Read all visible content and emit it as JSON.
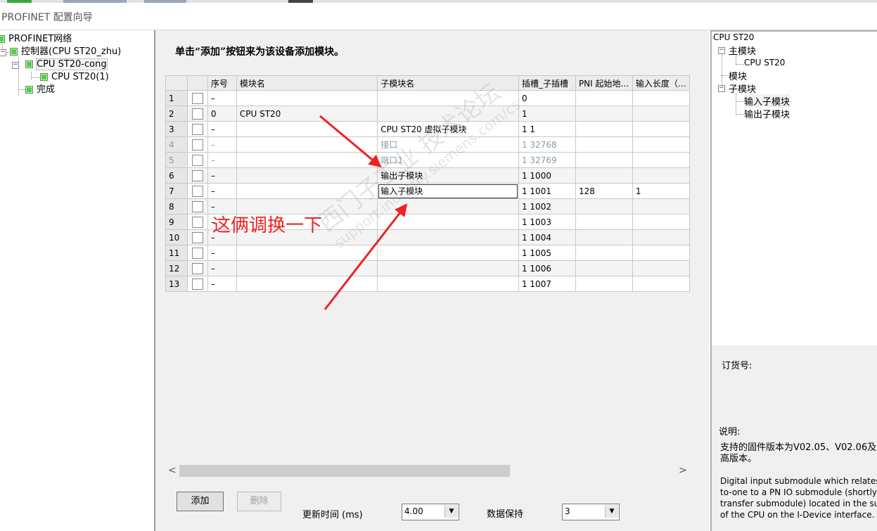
{
  "window": {
    "title": "PROFINET 配置向导"
  },
  "left_tree": {
    "items": [
      {
        "label": "PROFINET网络"
      },
      {
        "label": "控制器(CPU ST20_zhu)"
      },
      {
        "label": "CPU ST20-cong"
      },
      {
        "label": "CPU ST20(1)"
      },
      {
        "label": "完成"
      }
    ]
  },
  "center": {
    "instruction": "单击“添加”按钮来为该设备添加模块。",
    "columns": [
      "序号",
      "模块名",
      "子模块名",
      "插槽_子插槽",
      "PNI 起始地…",
      "输入长度（…"
    ],
    "rows": [
      {
        "num": "1",
        "seq": "–",
        "module": "",
        "submodule": "",
        "slot": "0",
        "pni": "",
        "len": ""
      },
      {
        "num": "2",
        "seq": "0",
        "module": "CPU ST20",
        "submodule": "",
        "slot": "1",
        "pni": "",
        "len": ""
      },
      {
        "num": "3",
        "seq": "–",
        "module": "",
        "submodule": "CPU ST20 虚拟子模块",
        "slot": "1 1",
        "pni": "",
        "len": ""
      },
      {
        "num": "4",
        "seq": "–",
        "module": "",
        "submodule": "接口",
        "slot": "1 32768",
        "pni": "",
        "len": ""
      },
      {
        "num": "5",
        "seq": "–",
        "module": "",
        "submodule": "端口1",
        "slot": "1 32769",
        "pni": "",
        "len": ""
      },
      {
        "num": "6",
        "seq": "–",
        "module": "",
        "submodule": "输出子模块",
        "slot": "1 1000",
        "pni": "",
        "len": ""
      },
      {
        "num": "7",
        "seq": "–",
        "module": "",
        "submodule": "输入子模块",
        "slot": "1 1001",
        "pni": "128",
        "len": "1"
      },
      {
        "num": "8",
        "seq": "–",
        "module": "",
        "submodule": "",
        "slot": "1 1002",
        "pni": "",
        "len": ""
      },
      {
        "num": "9",
        "seq": "–",
        "module": "",
        "submodule": "",
        "slot": "1 1003",
        "pni": "",
        "len": ""
      },
      {
        "num": "10",
        "seq": "–",
        "module": "",
        "submodule": "",
        "slot": "1 1004",
        "pni": "",
        "len": ""
      },
      {
        "num": "11",
        "seq": "–",
        "module": "",
        "submodule": "",
        "slot": "1 1005",
        "pni": "",
        "len": ""
      },
      {
        "num": "12",
        "seq": "–",
        "module": "",
        "submodule": "",
        "slot": "1 1006",
        "pni": "",
        "len": ""
      },
      {
        "num": "13",
        "seq": "–",
        "module": "",
        "submodule": "",
        "slot": "1 1007",
        "pni": "",
        "len": ""
      }
    ],
    "scroll_left": "<",
    "scroll_right": ">",
    "add_button": "添加",
    "delete_button": "删除",
    "update_time_label": "更新时间 (ms)",
    "update_time_value": "4.00",
    "data_hold_label": "数据保持",
    "data_hold_value": "3"
  },
  "right_tree": {
    "root": "CPU ST20",
    "main_module": "主模块",
    "main_module_child": "CPU ST20",
    "module": "模块",
    "submodule": "子模块",
    "submodule_children": [
      "输入子模块",
      "输出子模块"
    ]
  },
  "right_info": {
    "order_label": "订货号:",
    "desc_label": "说明:",
    "desc_cn_1": "支持的固件版本为V02.05、V02.06及",
    "desc_cn_2": "高版本。",
    "desc_en_1": "Digital input submodule which relates o",
    "desc_en_2": "to-one to a PN IO submodule (shortly c",
    "desc_en_3": "transfer submodule) located in the subs",
    "desc_en_4": "of the CPU on the I-Device interface."
  },
  "annotation": {
    "text": "这俩调换一下",
    "color": "#ee2222"
  },
  "watermark": {
    "line1": "西门子工业  技术论坛",
    "line2": "support.industry.siemens.com/cs"
  }
}
